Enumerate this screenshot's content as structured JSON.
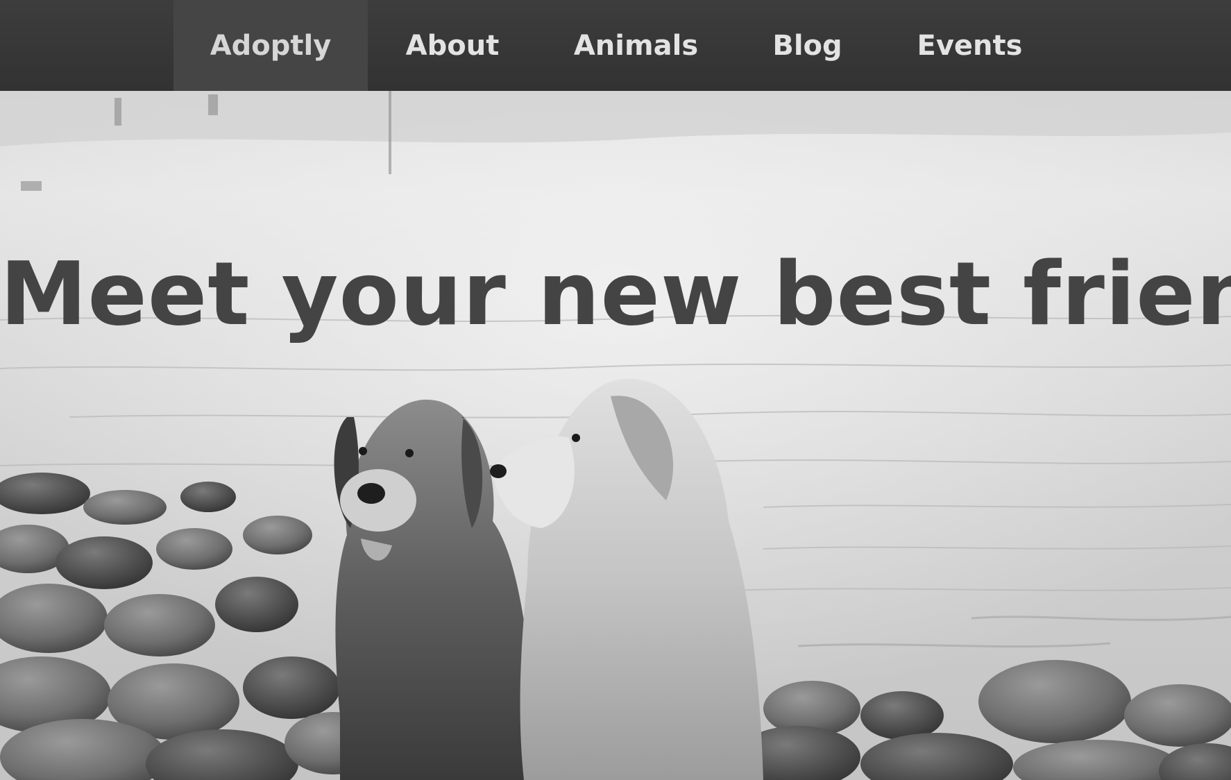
{
  "nav": {
    "brand": "Adoptly",
    "links": [
      "About",
      "Animals",
      "Blog",
      "Events"
    ]
  },
  "hero": {
    "headline": "Meet your new best friend.",
    "image": "two-golden-retrievers-on-rocky-beach",
    "filter": "grayscale"
  },
  "colors": {
    "nav_bg": "#363636",
    "brand_bg": "#454545",
    "nav_text": "#e3e3e3",
    "headline": "#444444"
  }
}
